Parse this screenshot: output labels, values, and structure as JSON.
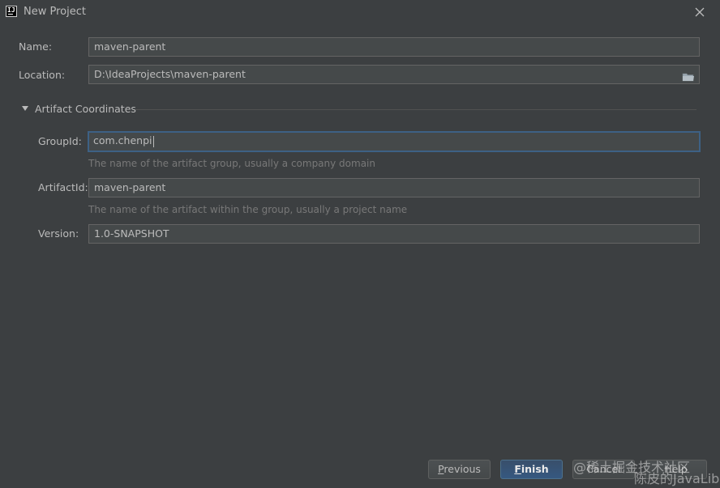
{
  "window": {
    "title": "New Project"
  },
  "form": {
    "name_label": "Name:",
    "name_value": "maven-parent",
    "location_label": "Location:",
    "location_value": "D:\\IdeaProjects\\maven-parent"
  },
  "artifact": {
    "section_title": "Artifact Coordinates",
    "group_label": "GroupId:",
    "group_value": "com.chenpi",
    "group_hint": "The name of the artifact group, usually a company domain",
    "artifact_label": "ArtifactId:",
    "artifact_value": "maven-parent",
    "artifact_hint": "The name of the artifact within the group, usually a project name",
    "version_label": "Version:",
    "version_value": "1.0-SNAPSHOT"
  },
  "buttons": {
    "previous_first": "P",
    "previous_rest": "revious",
    "finish_first": "F",
    "finish_rest": "inish",
    "cancel": "Cancel",
    "help": "Help"
  },
  "watermark": {
    "line1": "@稀土掘金技术社区",
    "line2": "陈皮的JavaLib"
  },
  "colors": {
    "background": "#3c3f41",
    "field": "#45494a",
    "focus_border": "#3d6185",
    "primary_button": "#365880"
  },
  "icons": {
    "app": "intellij-idea-logo",
    "close": "close-icon",
    "folder": "folder-icon",
    "section": "triangle-down-icon"
  }
}
